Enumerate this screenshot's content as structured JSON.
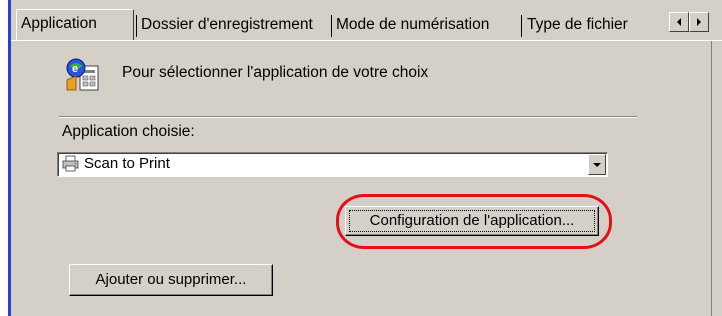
{
  "tabs": [
    {
      "label": "Application",
      "active": true
    },
    {
      "label": "Dossier d'enregistrement",
      "active": false
    },
    {
      "label": "Mode de numérisation",
      "active": false
    },
    {
      "label": "Type de fichier",
      "active": false
    }
  ],
  "tab_scroll": {
    "left_icon": "arrow-left-icon",
    "right_icon": "arrow-right-icon"
  },
  "info": {
    "icon": "application-settings-icon",
    "text": "Pour sélectionner l'application de votre choix"
  },
  "app_select": {
    "label": "Application choisie:",
    "value": "Scan to Print",
    "value_icon": "printer-icon",
    "dropdown_icon": "chevron-down-icon"
  },
  "buttons": {
    "config_label": "Configuration de l'application...",
    "add_remove_label": "Ajouter ou supprimer..."
  },
  "annotation": {
    "color": "#e3101a"
  },
  "colors": {
    "dialog_bg": "#d4d0c8",
    "window_border": "#2a3fd4"
  }
}
